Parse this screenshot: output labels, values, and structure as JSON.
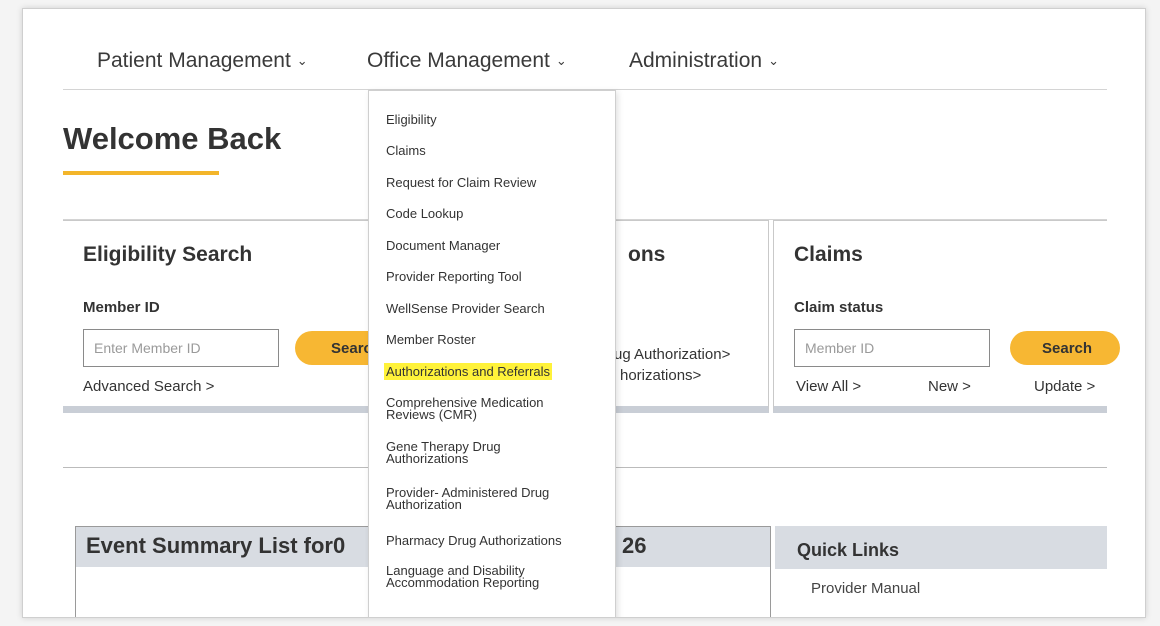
{
  "nav": {
    "items": [
      {
        "label": "Patient Management"
      },
      {
        "label": "Office Management"
      },
      {
        "label": "Administration"
      }
    ],
    "chevron": "⌄"
  },
  "welcome": {
    "title": "Welcome Back"
  },
  "cards": {
    "eligibility": {
      "title": "Eligibility Search",
      "subtitle": "Member ID",
      "placeholder": "Enter Member ID",
      "button": "Search",
      "link": "Advanced Search >"
    },
    "middle": {
      "title_tail": "ons",
      "link1": "ug Authorization>",
      "link2": "horizations>"
    },
    "claims": {
      "title": "Claims",
      "subtitle": "Claim status",
      "placeholder": "Member ID",
      "button": "Search",
      "links": [
        "View All >",
        "New >",
        "Update >"
      ]
    }
  },
  "event": {
    "title": "Event Summary List for0",
    "tail": "26"
  },
  "quick_links": {
    "title": "Quick Links",
    "item": "Provider Manual"
  },
  "dropdown": {
    "items": [
      "Eligibility",
      "Claims",
      "Request for Claim Review",
      "Code Lookup",
      "Document Manager",
      "Provider Reporting Tool",
      "WellSense Provider Search",
      "Member Roster",
      "Authorizations and Referrals",
      "Comprehensive Medication\nReviews (CMR)",
      "Gene Therapy Drug\nAuthorizations",
      "Provider- Administered Drug\nAuthorization",
      "Pharmacy Drug Authorizations",
      "Language and Disability\nAccommodation Reporting"
    ],
    "highlighted": "Authorizations and Referrals",
    "highlight_color": "#fff23a"
  },
  "colors": {
    "accent": "#f7b733",
    "panel": "#d8dce2"
  }
}
